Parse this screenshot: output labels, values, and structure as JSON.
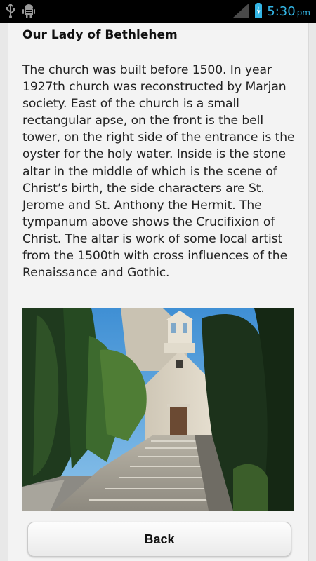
{
  "status_bar": {
    "time": "5:30",
    "ampm": "pm",
    "icons": [
      "usb-icon",
      "android-debug-icon",
      "signal-icon",
      "battery-charging-icon"
    ]
  },
  "article": {
    "title": "Our Lady of Bethlehem",
    "body": "The church was built before 1500. In year 1927th church was reconstructed by Marjan society. East of the church is a small rectangular apse, on the front is the bell tower, on the right side of the entrance is the oyster for the holy water. Inside is the stone altar in the middle of which is the scene of Christ’s birth, the side characters are St. Jerome and St. Anthony the Hermit. The tympanum above shows the Crucifixion of Christ. The altar is work of some local artist from the 1500th with cross influences of the Renaissance and Gothic."
  },
  "footer": {
    "back_label": "Back"
  },
  "colors": {
    "status_accent": "#33b5e5",
    "background": "#f3f3f3"
  }
}
